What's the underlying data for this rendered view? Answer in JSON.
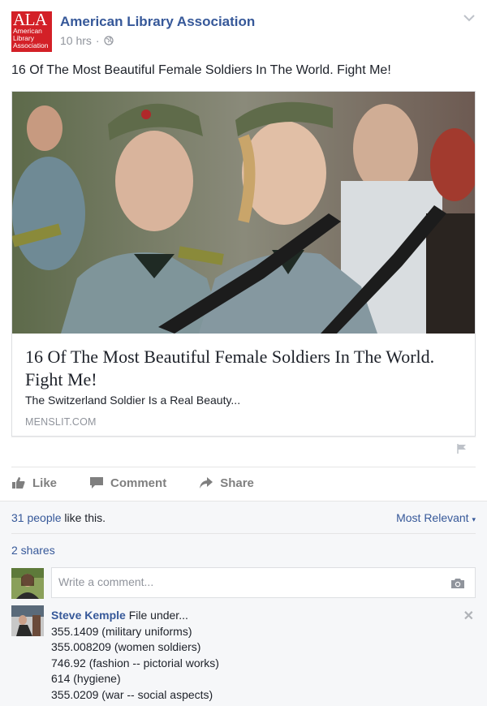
{
  "header": {
    "logo_big": "ALA",
    "logo_small": [
      "American",
      "Library",
      "Association"
    ],
    "page_name": "American Library Association",
    "time": "10 hrs",
    "separator": "·"
  },
  "post": {
    "caption": "16 Of The Most Beautiful Female Soldiers In The World. Fight Me!"
  },
  "link_card": {
    "title": "16 Of The Most Beautiful Female Soldiers In The World. Fight Me!",
    "description": "The Switzerland Soldier Is a Real Beauty...",
    "domain": "MENSLIT.COM"
  },
  "actions": {
    "like": "Like",
    "comment": "Comment",
    "share": "Share"
  },
  "feedback": {
    "likes_count": "31 people",
    "likes_suffix": " like this.",
    "sort": "Most Relevant",
    "shares": "2 shares",
    "comment_placeholder": "Write a comment..."
  },
  "comments": [
    {
      "author": "Steve Kemple",
      "lines": [
        "File under...",
        "355.1409 (military uniforms)",
        "355.008209 (women soldiers)",
        "746.92 (fashion -- pictorial works)",
        "614 (hygiene)",
        "355.0209 (war -- social aspects)"
      ]
    }
  ],
  "colors": {
    "link": "#365899",
    "brand_red": "#d32027",
    "muted": "#90949c"
  }
}
